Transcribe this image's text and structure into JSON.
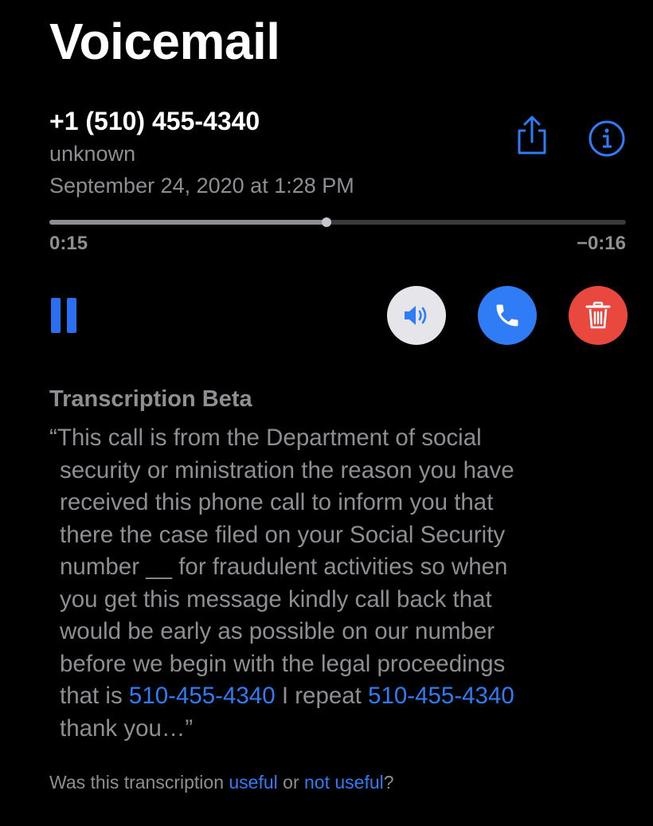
{
  "header": {
    "title": "Voicemail"
  },
  "voicemail": {
    "caller": "+1 (510) 455-4340",
    "label": "unknown",
    "date": "September 24, 2020 at 1:28 PM"
  },
  "playback": {
    "elapsed": "0:15",
    "remaining": "−0:16",
    "progress_fraction": 0.48
  },
  "icons": {
    "share": "share-icon",
    "info": "info-icon",
    "pause": "pause-icon",
    "speaker": "speaker-icon",
    "call": "phone-icon",
    "delete": "trash-icon"
  },
  "colors": {
    "accent": "#2f7cf6",
    "delete": "#e9483f",
    "secondary_text": "#8e8e93"
  },
  "transcription": {
    "heading": "Transcription Beta",
    "lines": [
      "“This call is from the Department of social",
      "security or ministration the reason you have",
      "received this phone call to inform you that",
      "there the case filed on your Social Security",
      "number __ for fraudulent activities so when",
      "you get this message kindly call back that",
      "would be early as possible on our number",
      "before we begin with the legal proceedings"
    ],
    "line9_a": "that is ",
    "phone_link_1": "510-455-4340",
    "line9_b": " I repeat ",
    "phone_link_2": "510-455-4340",
    "last_line": "thank you…”"
  },
  "feedback": {
    "prefix": "Was this transcription ",
    "useful": "useful",
    "or": " or ",
    "not_useful": "not useful",
    "suffix": "?"
  }
}
